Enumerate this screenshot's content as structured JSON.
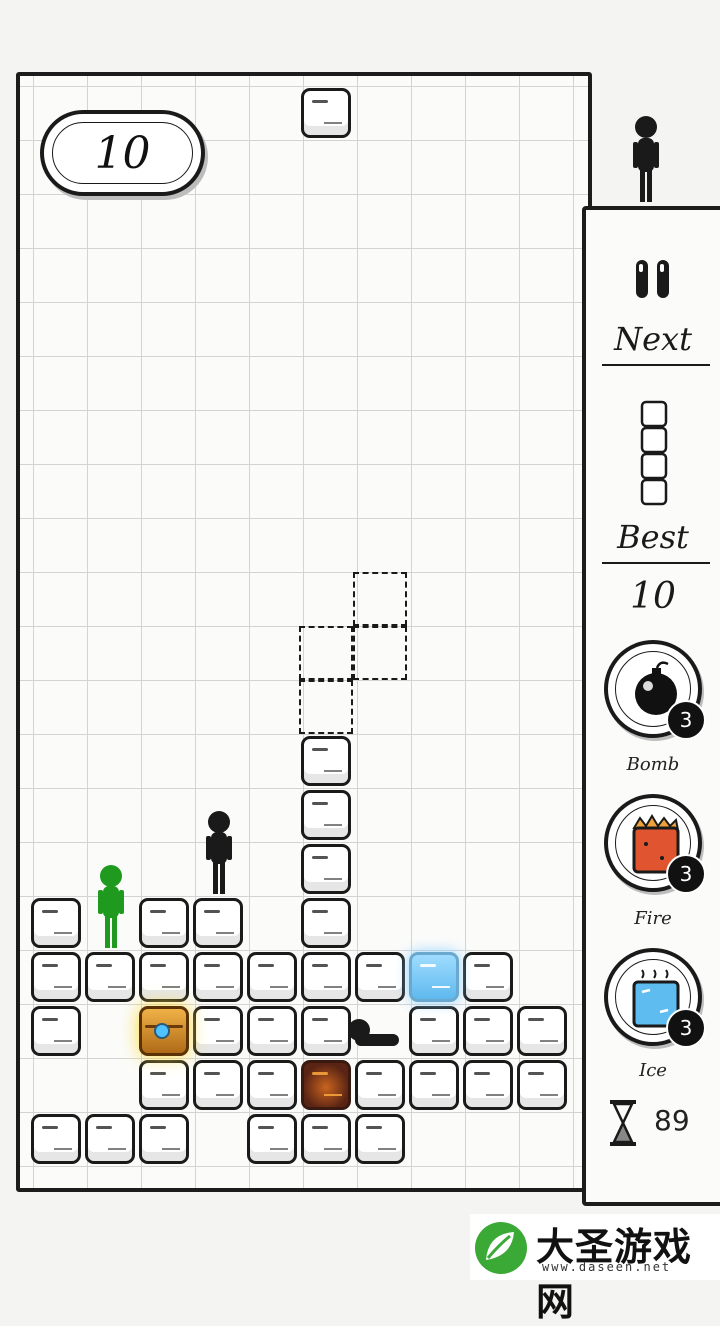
{
  "score": "10",
  "sidebar": {
    "next_label": "Next",
    "best_label": "Best",
    "best_value": "10",
    "timer_value": "89"
  },
  "powerups": [
    {
      "name": "Bomb",
      "count": "3"
    },
    {
      "name": "Fire",
      "count": "3"
    },
    {
      "name": "Ice",
      "count": "3"
    }
  ],
  "watermark": {
    "title": "大圣游戏网",
    "url": "www.daseen.net"
  },
  "colors": {
    "ink": "#1a1a1a",
    "ice": "#6cc4f5",
    "fire": "#b8561e",
    "chest": "#e09a2c",
    "green_stickman": "#1f9a1f",
    "logo_green": "#3aa935"
  },
  "board": {
    "columns": 10,
    "rows_visible": 20,
    "falling_piece_cells": [
      [
        5,
        0
      ]
    ],
    "ghost_cells": [
      [
        6,
        9
      ],
      [
        5,
        10
      ],
      [
        6,
        10
      ],
      [
        5,
        11
      ]
    ],
    "blocks": [
      [
        5,
        12
      ],
      [
        5,
        13
      ],
      [
        5,
        14
      ],
      [
        5,
        15
      ],
      [
        0,
        15
      ],
      [
        2,
        15
      ],
      [
        3,
        15
      ],
      [
        0,
        16
      ],
      [
        1,
        16
      ],
      [
        2,
        16
      ],
      [
        3,
        16
      ],
      [
        4,
        16
      ],
      [
        5,
        16
      ],
      [
        6,
        16
      ],
      [
        8,
        16
      ],
      [
        0,
        17
      ],
      [
        3,
        17
      ],
      [
        4,
        17
      ],
      [
        5,
        17
      ],
      [
        7,
        17
      ],
      [
        8,
        17
      ],
      [
        9,
        17
      ],
      [
        2,
        18
      ],
      [
        3,
        18
      ],
      [
        4,
        18
      ],
      [
        6,
        18
      ],
      [
        7,
        18
      ],
      [
        8,
        18
      ],
      [
        9,
        18
      ],
      [
        0,
        19
      ],
      [
        1,
        19
      ],
      [
        2,
        19
      ],
      [
        4,
        19
      ],
      [
        5,
        19
      ],
      [
        6,
        19
      ]
    ],
    "special_blocks": [
      {
        "type": "ice",
        "cell": [
          7,
          16
        ]
      },
      {
        "type": "chest",
        "cell": [
          2,
          17
        ]
      },
      {
        "type": "fire",
        "cell": [
          5,
          18
        ]
      }
    ]
  }
}
